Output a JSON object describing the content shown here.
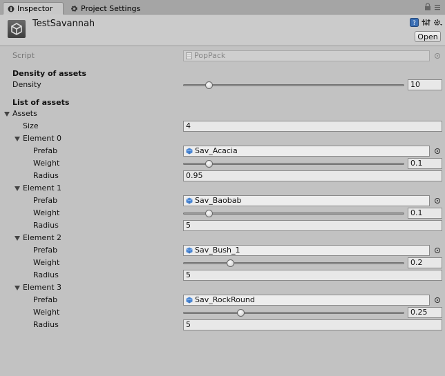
{
  "tabs": [
    {
      "label": "Inspector",
      "icon": "info-icon"
    },
    {
      "label": "Project Settings",
      "icon": "gear-icon"
    }
  ],
  "header": {
    "title": "TestSavannah",
    "open_label": "Open"
  },
  "script": {
    "label": "Script",
    "value": "PopPack"
  },
  "density_section": {
    "title": "Density of assets",
    "label": "Density",
    "value": "10",
    "fraction": 0.1
  },
  "list_section": {
    "title": "List of assets",
    "assets_label": "Assets",
    "size_label": "Size",
    "size_value": "4"
  },
  "elements": [
    {
      "label": "Element 0",
      "prefab_label": "Prefab",
      "prefab": "Sav_Acacia",
      "weight_label": "Weight",
      "weight": "0.1",
      "weight_fraction": 0.1,
      "radius_label": "Radius",
      "radius": "0.95"
    },
    {
      "label": "Element 1",
      "prefab_label": "Prefab",
      "prefab": "Sav_Baobab",
      "weight_label": "Weight",
      "weight": "0.1",
      "weight_fraction": 0.1,
      "radius_label": "Radius",
      "radius": "5"
    },
    {
      "label": "Element 2",
      "prefab_label": "Prefab",
      "prefab": "Sav_Bush_1",
      "weight_label": "Weight",
      "weight": "0.2",
      "weight_fraction": 0.2,
      "radius_label": "Radius",
      "radius": "5"
    },
    {
      "label": "Element 3",
      "prefab_label": "Prefab",
      "prefab": "Sav_RockRound",
      "weight_label": "Weight",
      "weight": "0.25",
      "weight_fraction": 0.25,
      "radius_label": "Radius",
      "radius": "5"
    }
  ],
  "colors": {
    "background": "#c2c2c2",
    "cube": "#4a86d4"
  }
}
